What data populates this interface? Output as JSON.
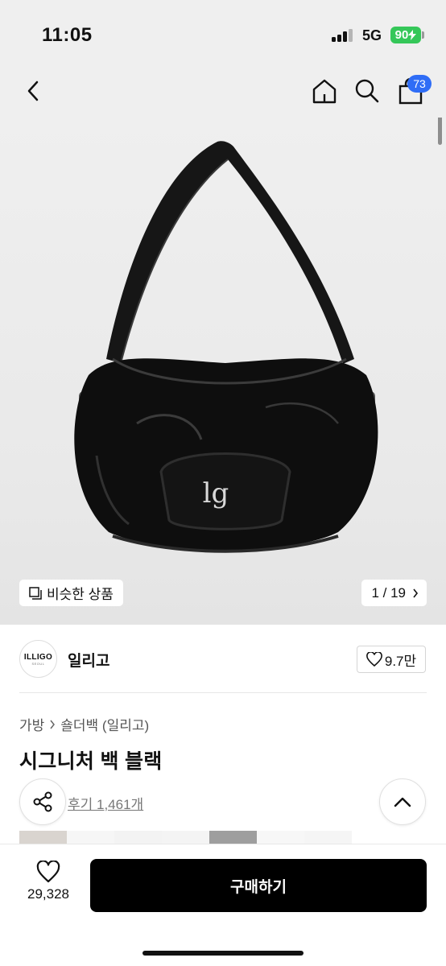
{
  "status": {
    "time": "11:05",
    "network": "5G",
    "battery": "90"
  },
  "nav": {
    "back_icon": "chevron-left-icon",
    "home_icon": "home-icon",
    "search_icon": "search-icon",
    "cart_icon": "shopping-bag-icon",
    "cart_count": "73"
  },
  "hero": {
    "similar_label": "비슷한 상품",
    "counter": "1 / 19"
  },
  "brand": {
    "logo_text": "ILLIGO",
    "logo_sub": "SEOUL",
    "name": "일리고",
    "likes": "9.7만"
  },
  "product": {
    "breadcrumb": [
      "가방",
      "숄더백 (일리고)"
    ],
    "title": "시그니처 백 블랙",
    "review_link": "후기 1,461개"
  },
  "bottom": {
    "wish_count": "29,328",
    "buy_label": "구매하기"
  },
  "colors": {
    "accent_badge": "#2f6df6",
    "battery": "#35c759",
    "buy_button": "#000000"
  }
}
